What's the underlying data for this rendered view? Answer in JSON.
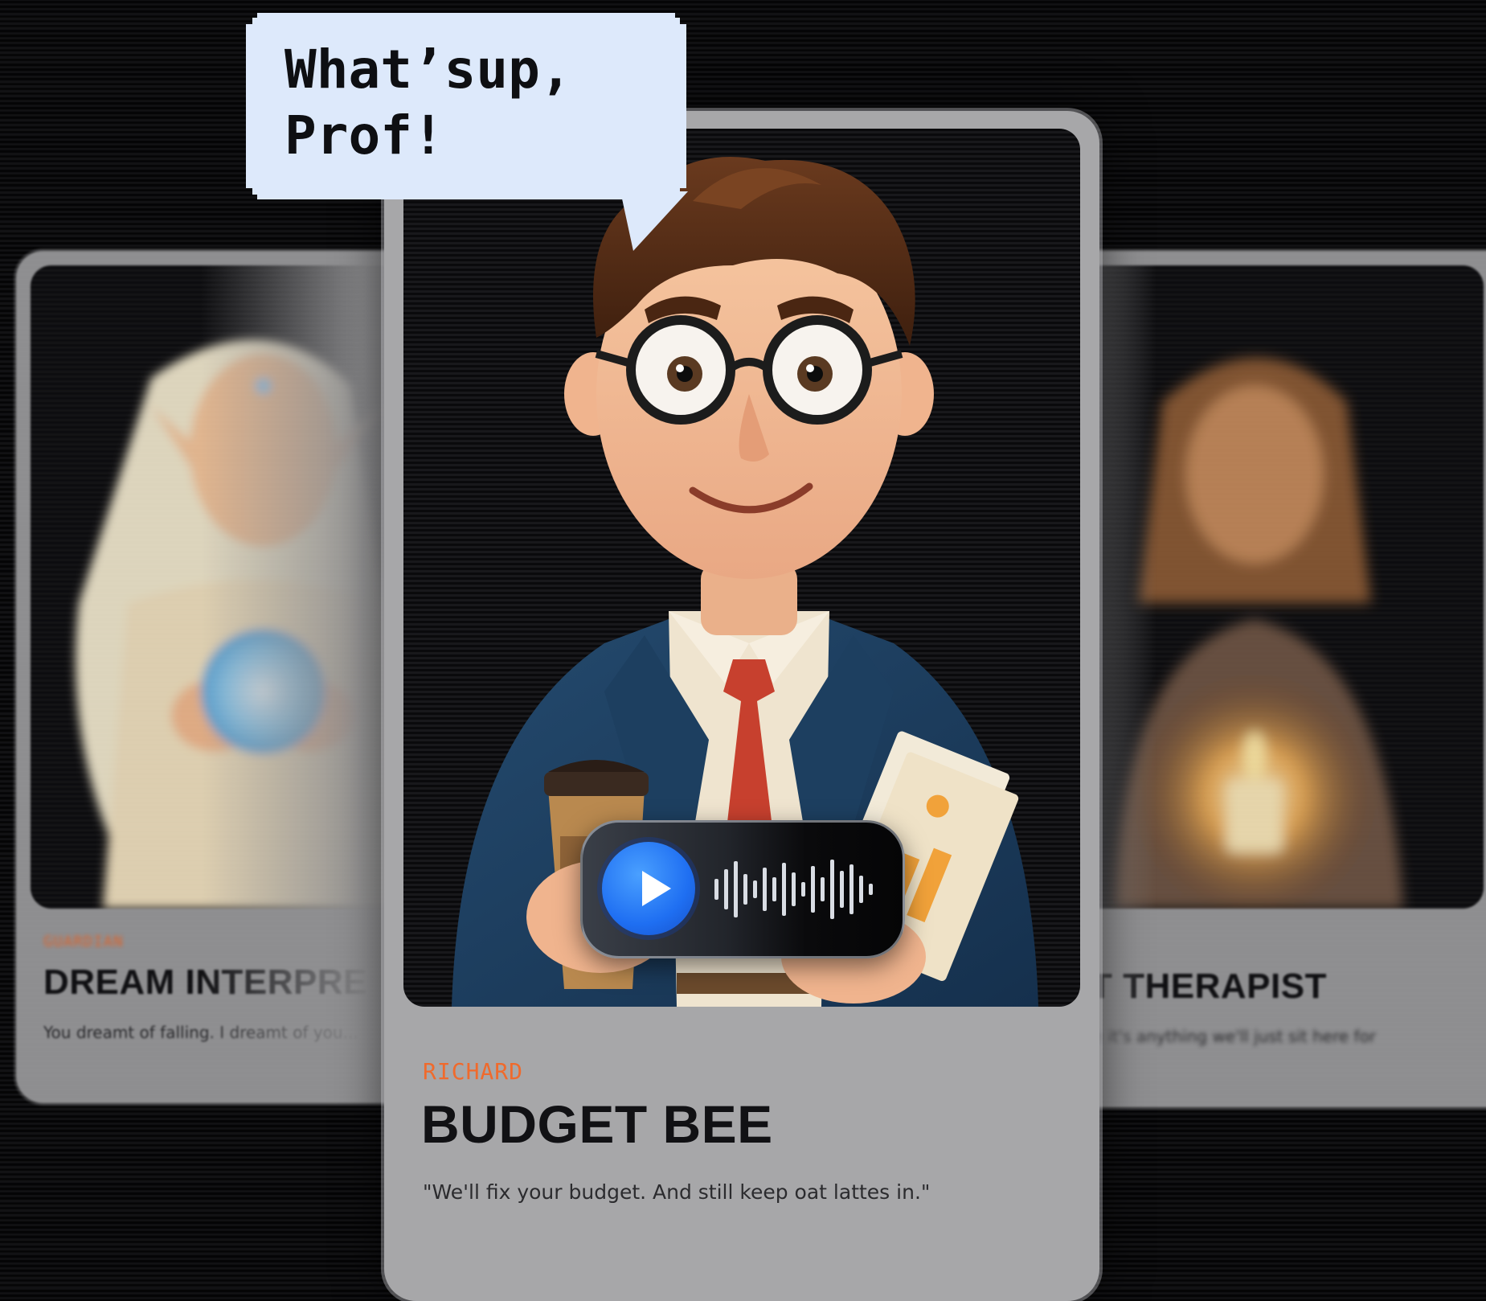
{
  "speech_bubble": {
    "text": "What’sup, Prof!"
  },
  "cards": {
    "left": {
      "character_name": "GUARDIAN",
      "title": "DREAM INTERPRE",
      "description": "You dreamt of falling. I dreamt of you..."
    },
    "center": {
      "character_name": "RICHARD",
      "title": "BUDGET BEE",
      "description": "\"We'll fix your budget. And still keep oat lattes in.\""
    },
    "right": {
      "character_name": "",
      "title": "GHT THERAPIST",
      "description": "...ure it's anything we'll just sit here for"
    }
  },
  "audio_player": {
    "play_icon": "play-icon",
    "waveform_icon": "waveform-icon"
  },
  "colors": {
    "background": "#0b0b0c",
    "card": "#a7a7a9",
    "accent_orange": "#f06a2c",
    "bubble": "#dde9fb",
    "play_blue": "#1f6ff2"
  }
}
